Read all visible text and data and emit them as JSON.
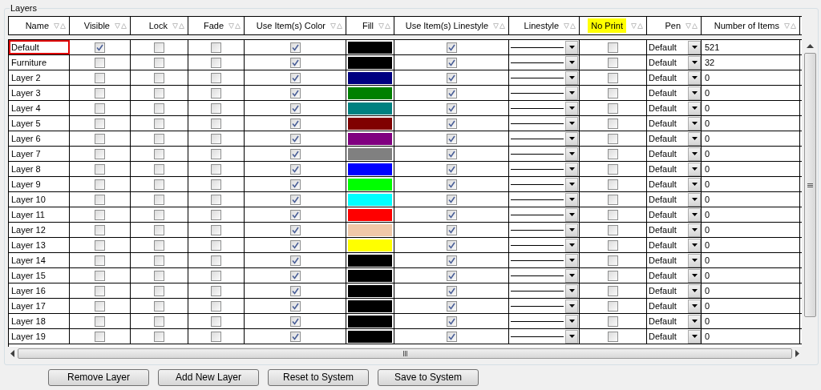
{
  "group": {
    "title": "Layers"
  },
  "columns": [
    {
      "label": "Name",
      "highlighted": false
    },
    {
      "label": "Visible",
      "highlighted": false
    },
    {
      "label": "Lock",
      "highlighted": false
    },
    {
      "label": "Fade",
      "highlighted": false
    },
    {
      "label": "Use Item(s) Color",
      "highlighted": false
    },
    {
      "label": "Fill",
      "highlighted": false
    },
    {
      "label": "Use Item(s) Linestyle",
      "highlighted": false
    },
    {
      "label": "Linestyle",
      "highlighted": false
    },
    {
      "label": "No Print",
      "highlighted": true
    },
    {
      "label": "Pen",
      "highlighted": false
    },
    {
      "label": "Number of Items",
      "highlighted": false
    }
  ],
  "rows": [
    {
      "name": "Default",
      "selected": true,
      "visible": true,
      "lock": false,
      "fade": false,
      "use_color": true,
      "color": "#000000",
      "use_linestyle": true,
      "no_print": false,
      "pen": "Default",
      "count": "521"
    },
    {
      "name": "Furniture",
      "selected": false,
      "visible": false,
      "lock": false,
      "fade": false,
      "use_color": true,
      "color": "#000000",
      "use_linestyle": true,
      "no_print": false,
      "pen": "Default",
      "count": "32"
    },
    {
      "name": "Layer 2",
      "selected": false,
      "visible": false,
      "lock": false,
      "fade": false,
      "use_color": true,
      "color": "#000080",
      "use_linestyle": true,
      "no_print": false,
      "pen": "Default",
      "count": "0"
    },
    {
      "name": "Layer 3",
      "selected": false,
      "visible": false,
      "lock": false,
      "fade": false,
      "use_color": true,
      "color": "#008000",
      "use_linestyle": true,
      "no_print": false,
      "pen": "Default",
      "count": "0"
    },
    {
      "name": "Layer 4",
      "selected": false,
      "visible": false,
      "lock": false,
      "fade": false,
      "use_color": true,
      "color": "#008080",
      "use_linestyle": true,
      "no_print": false,
      "pen": "Default",
      "count": "0"
    },
    {
      "name": "Layer 5",
      "selected": false,
      "visible": false,
      "lock": false,
      "fade": false,
      "use_color": true,
      "color": "#800000",
      "use_linestyle": true,
      "no_print": false,
      "pen": "Default",
      "count": "0"
    },
    {
      "name": "Layer 6",
      "selected": false,
      "visible": false,
      "lock": false,
      "fade": false,
      "use_color": true,
      "color": "#800080",
      "use_linestyle": true,
      "no_print": false,
      "pen": "Default",
      "count": "0"
    },
    {
      "name": "Layer 7",
      "selected": false,
      "visible": false,
      "lock": false,
      "fade": false,
      "use_color": true,
      "color": "#808080",
      "use_linestyle": true,
      "no_print": false,
      "pen": "Default",
      "count": "0"
    },
    {
      "name": "Layer 8",
      "selected": false,
      "visible": false,
      "lock": false,
      "fade": false,
      "use_color": true,
      "color": "#0000ff",
      "use_linestyle": true,
      "no_print": false,
      "pen": "Default",
      "count": "0"
    },
    {
      "name": "Layer 9",
      "selected": false,
      "visible": false,
      "lock": false,
      "fade": false,
      "use_color": true,
      "color": "#00ff00",
      "use_linestyle": true,
      "no_print": false,
      "pen": "Default",
      "count": "0"
    },
    {
      "name": "Layer 10",
      "selected": false,
      "visible": false,
      "lock": false,
      "fade": false,
      "use_color": true,
      "color": "#00ffff",
      "use_linestyle": true,
      "no_print": false,
      "pen": "Default",
      "count": "0"
    },
    {
      "name": "Layer 11",
      "selected": false,
      "visible": false,
      "lock": false,
      "fade": false,
      "use_color": true,
      "color": "#ff0000",
      "use_linestyle": true,
      "no_print": false,
      "pen": "Default",
      "count": "0"
    },
    {
      "name": "Layer 12",
      "selected": false,
      "visible": false,
      "lock": false,
      "fade": false,
      "use_color": true,
      "color": "#f0c8a8",
      "use_linestyle": true,
      "no_print": false,
      "pen": "Default",
      "count": "0"
    },
    {
      "name": "Layer 13",
      "selected": false,
      "visible": false,
      "lock": false,
      "fade": false,
      "use_color": true,
      "color": "#ffff00",
      "use_linestyle": true,
      "no_print": false,
      "pen": "Default",
      "count": "0"
    },
    {
      "name": "Layer 14",
      "selected": false,
      "visible": false,
      "lock": false,
      "fade": false,
      "use_color": true,
      "color": "#000000",
      "use_linestyle": true,
      "no_print": false,
      "pen": "Default",
      "count": "0"
    },
    {
      "name": "Layer 15",
      "selected": false,
      "visible": false,
      "lock": false,
      "fade": false,
      "use_color": true,
      "color": "#000000",
      "use_linestyle": true,
      "no_print": false,
      "pen": "Default",
      "count": "0"
    },
    {
      "name": "Layer 16",
      "selected": false,
      "visible": false,
      "lock": false,
      "fade": false,
      "use_color": true,
      "color": "#000000",
      "use_linestyle": true,
      "no_print": false,
      "pen": "Default",
      "count": "0"
    },
    {
      "name": "Layer 17",
      "selected": false,
      "visible": false,
      "lock": false,
      "fade": false,
      "use_color": true,
      "color": "#000000",
      "use_linestyle": true,
      "no_print": false,
      "pen": "Default",
      "count": "0"
    },
    {
      "name": "Layer 18",
      "selected": false,
      "visible": false,
      "lock": false,
      "fade": false,
      "use_color": true,
      "color": "#000000",
      "use_linestyle": true,
      "no_print": false,
      "pen": "Default",
      "count": "0"
    },
    {
      "name": "Layer 19",
      "selected": false,
      "visible": false,
      "lock": false,
      "fade": false,
      "use_color": true,
      "color": "#000000",
      "use_linestyle": true,
      "no_print": false,
      "pen": "Default",
      "count": "0"
    }
  ],
  "buttons": [
    "Remove Layer",
    "Add New Layer",
    "Reset to System",
    "Save to System"
  ]
}
